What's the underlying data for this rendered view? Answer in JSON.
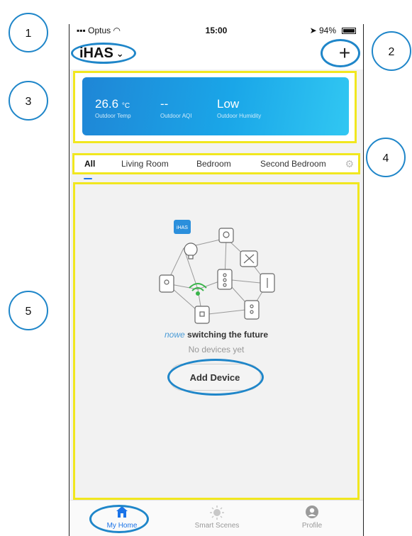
{
  "status_bar": {
    "carrier": "Optus",
    "time": "15:00",
    "battery": "94%"
  },
  "header": {
    "home_name": "iHAS",
    "chevron": "⌄",
    "add_label": "+"
  },
  "weather": {
    "temp_value": "26.6",
    "temp_unit": "°C",
    "temp_label": "Outdoor Temp",
    "aqi_value": "--",
    "aqi_label": "Outdoor AQI",
    "humidity_value": "Low",
    "humidity_label": "Outdoor Humidity"
  },
  "tabs": [
    {
      "label": "All",
      "active": true
    },
    {
      "label": "Living Room",
      "active": false
    },
    {
      "label": "Bedroom",
      "active": false
    },
    {
      "label": "Second Bedroom",
      "active": false
    }
  ],
  "empty_state": {
    "logo_badge": "iHAS",
    "brand_logo": "nowe",
    "brand_tagline": "switching the future",
    "message": "No devices yet",
    "add_button": "Add Device"
  },
  "bottom_nav": [
    {
      "label": "My Home",
      "icon": "home-icon",
      "active": true
    },
    {
      "label": "Smart Scenes",
      "icon": "sun-icon",
      "active": false
    },
    {
      "label": "Profile",
      "icon": "profile-icon",
      "active": false
    }
  ],
  "callouts": [
    "1",
    "2",
    "3",
    "4",
    "5"
  ],
  "colors": {
    "accent": "#1a73e8",
    "highlight": "#f1e71f",
    "callout_ring": "#1f86c9",
    "card_start": "#1f86d6",
    "card_end": "#31c7f2"
  }
}
